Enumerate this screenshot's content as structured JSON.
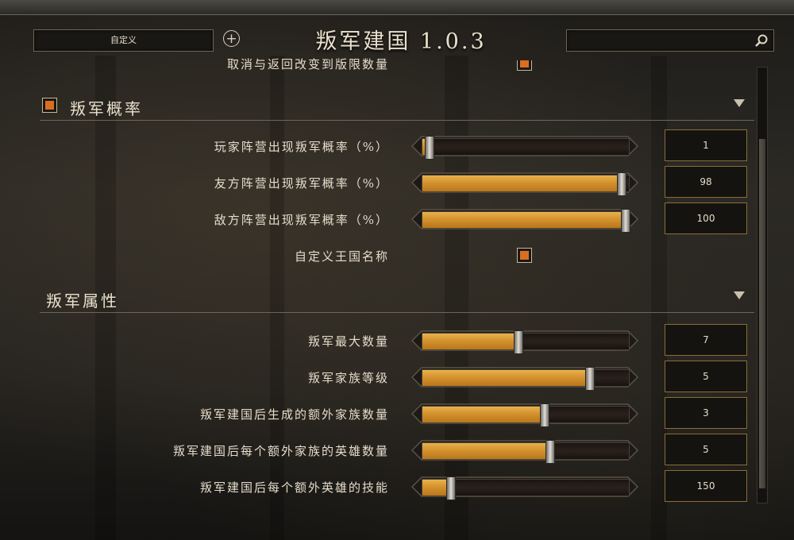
{
  "header": {
    "profile_label": "自定义",
    "title": "叛军建国 1.0.3",
    "search_value": ""
  },
  "partial_row": {
    "label": "取消与返回改变到版限数量",
    "checked": true
  },
  "sections": [
    {
      "title": "叛军概率",
      "checked": true,
      "rows": [
        {
          "type": "slider",
          "label": "玩家阵营出现叛军概率（%）",
          "value": "1",
          "fill": 0.01
        },
        {
          "type": "slider",
          "label": "友方阵营出现叛军概率（%）",
          "value": "98",
          "fill": 0.98
        },
        {
          "type": "slider",
          "label": "敌方阵营出现叛军概率（%）",
          "value": "100",
          "fill": 1.0
        },
        {
          "type": "checkbox",
          "label": "自定义王国名称",
          "checked": true
        }
      ]
    },
    {
      "title": "叛军属性",
      "rows": [
        {
          "type": "slider",
          "label": "叛军最大数量",
          "value": "7",
          "fill": 0.46
        },
        {
          "type": "slider",
          "label": "叛军家族等级",
          "value": "5",
          "fill": 0.82
        },
        {
          "type": "slider",
          "label": "叛军建国后生成的额外家族数量",
          "value": "3",
          "fill": 0.59
        },
        {
          "type": "slider",
          "label": "叛军建国后每个额外家族的英雄数量",
          "value": "5",
          "fill": 0.62
        },
        {
          "type": "slider",
          "label": "叛军建国后每个额外英雄的技能",
          "value": "150",
          "fill": 0.12
        }
      ]
    }
  ],
  "colors": {
    "accent_orange": "#d96f1e",
    "slider_fill": "#d4922e",
    "value_border": "#8a6c39"
  }
}
